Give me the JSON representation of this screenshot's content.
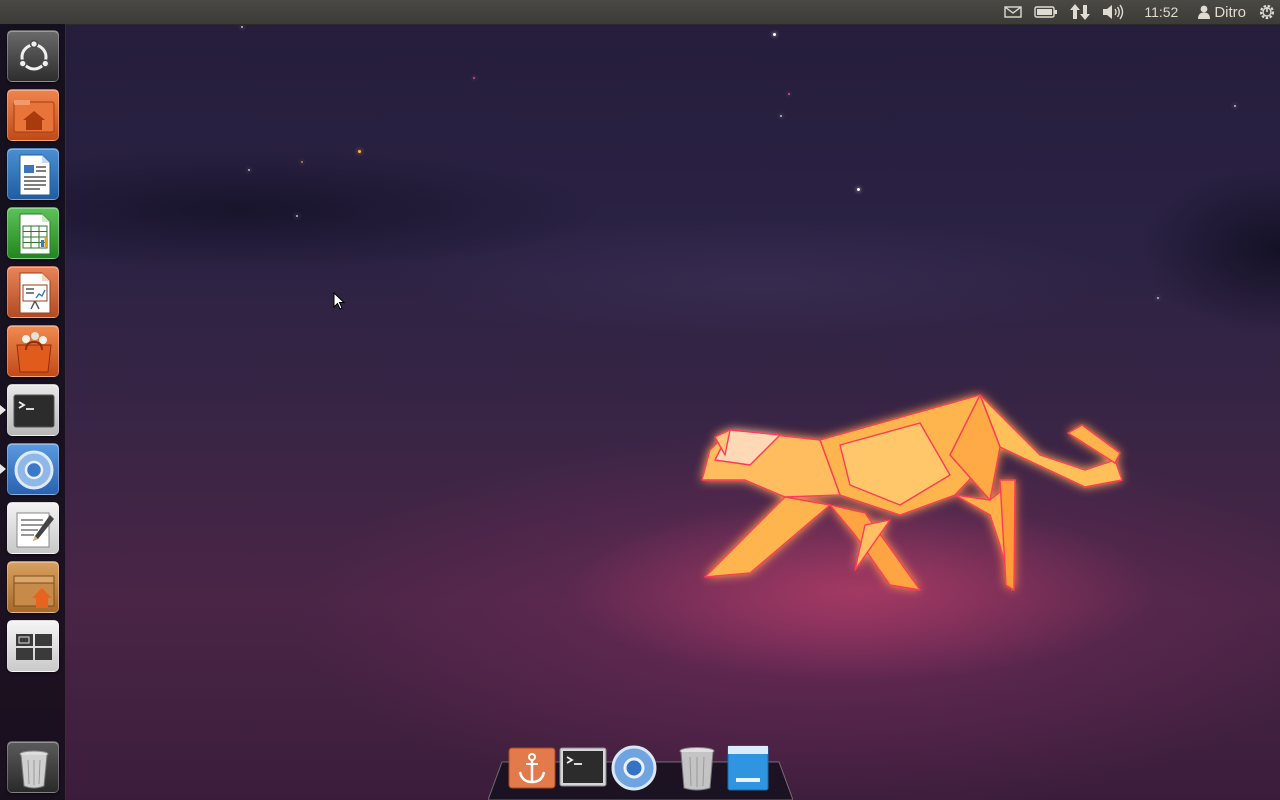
{
  "top_panel": {
    "indicators": [
      {
        "name": "messaging-indicator",
        "icon": "mail-icon"
      },
      {
        "name": "battery-indicator",
        "icon": "battery-icon"
      },
      {
        "name": "network-indicator",
        "icon": "network-arrows-icon"
      },
      {
        "name": "sound-indicator",
        "icon": "speaker-icon"
      }
    ],
    "clock": "11:52",
    "user": "Ditro",
    "session_icon": "gear-power-icon"
  },
  "launcher": {
    "items": [
      {
        "name": "dash-home",
        "icon": "ubuntu-logo-icon",
        "running": false
      },
      {
        "name": "home-folder",
        "icon": "home-folder-icon",
        "running": false
      },
      {
        "name": "libreoffice-writer",
        "icon": "writer-document-icon",
        "running": false
      },
      {
        "name": "libreoffice-calc",
        "icon": "calc-spreadsheet-icon",
        "running": false
      },
      {
        "name": "libreoffice-impress",
        "icon": "impress-presentation-icon",
        "running": false
      },
      {
        "name": "software-center",
        "icon": "shopping-bag-icon",
        "running": false
      },
      {
        "name": "terminal",
        "icon": "terminal-icon",
        "running": true
      },
      {
        "name": "chromium-browser",
        "icon": "chromium-icon",
        "running": true
      },
      {
        "name": "text-editor",
        "icon": "text-editor-icon",
        "running": false
      },
      {
        "name": "archive-manager",
        "icon": "package-icon",
        "running": false
      },
      {
        "name": "workspace-switcher",
        "icon": "workspaces-icon",
        "running": false
      }
    ],
    "trash": {
      "name": "trash",
      "icon": "trash-icon"
    }
  },
  "dock": {
    "items": [
      {
        "name": "docky",
        "icon": "anchor-icon"
      },
      {
        "name": "terminal",
        "icon": "terminal-icon"
      },
      {
        "name": "chromium-browser",
        "icon": "chromium-icon"
      },
      {
        "name": "trash",
        "icon": "trash-icon"
      },
      {
        "name": "removable-drive",
        "icon": "drive-icon"
      }
    ]
  },
  "colors": {
    "panel": "#3c3b37",
    "launcher_bg": "#120e18",
    "ubuntu_orange": "#dd4814",
    "cat_glow": "#ff3355",
    "cat_body": "#ffb54d"
  }
}
